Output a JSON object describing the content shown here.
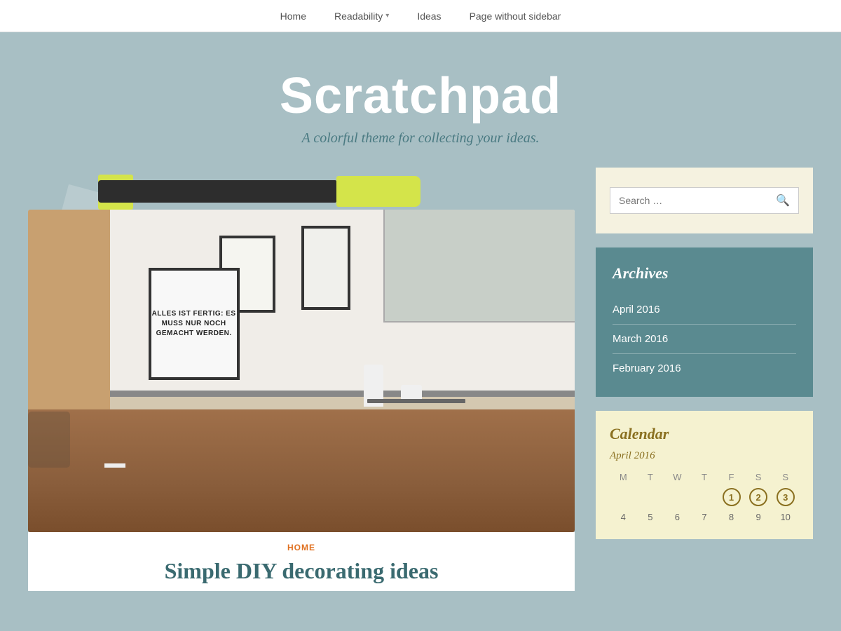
{
  "nav": {
    "home_label": "Home",
    "readability_label": "Readability",
    "ideas_label": "Ideas",
    "page_without_sidebar_label": "Page without sidebar"
  },
  "hero": {
    "title": "Scratchpad",
    "subtitle": "A colorful theme for collecting your ideas."
  },
  "post": {
    "category": "HOME",
    "title": "Simple DIY decorating ideas",
    "sign_text": "ALLES IST FERTIG: ES MUSS NUR NOCH GEMACHT WERDEN."
  },
  "sidebar": {
    "search": {
      "placeholder": "Search …"
    },
    "archives": {
      "title": "Archives",
      "items": [
        {
          "label": "April 2016"
        },
        {
          "label": "March 2016"
        },
        {
          "label": "February 2016"
        }
      ]
    },
    "calendar": {
      "title": "Calendar",
      "month": "April 2016",
      "days_header": [
        "M",
        "T",
        "W",
        "T",
        "F",
        "S",
        "S"
      ],
      "circled_days": [
        1,
        2,
        3
      ]
    }
  }
}
